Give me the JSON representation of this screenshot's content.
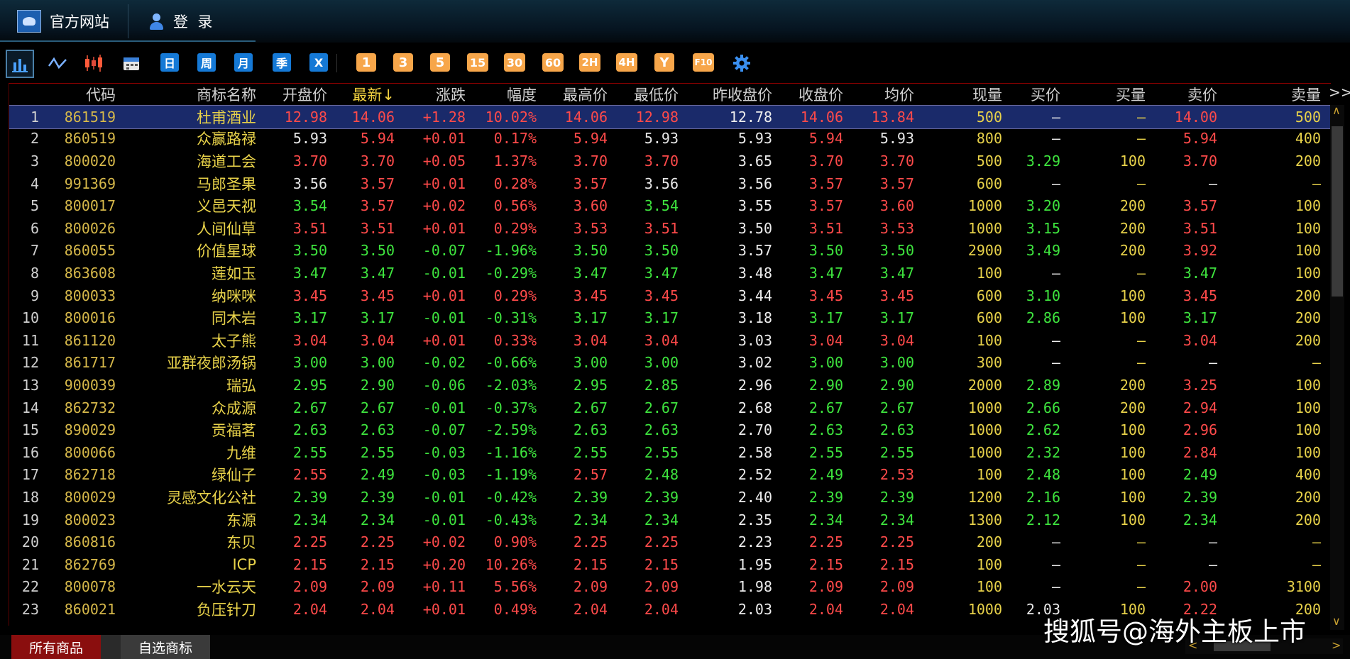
{
  "titlebar": {
    "official_site": "官方网站",
    "login": "登  录"
  },
  "toolbar": {
    "period_buttons": [
      "日",
      "周",
      "月",
      "季",
      "X"
    ],
    "minute_buttons": [
      "1",
      "3",
      "5",
      "15",
      "30",
      "60",
      "2H",
      "4H",
      "Y",
      "F10"
    ]
  },
  "table": {
    "headers": [
      "代码",
      "商标名称",
      "开盘价",
      "最新↓",
      "涨跌",
      "幅度",
      "最高价",
      "最低价",
      "昨收盘价",
      "收盘价",
      "均价",
      "现量",
      "买价",
      "买量",
      "卖价",
      "卖量"
    ],
    "more": ">>",
    "rows": [
      [
        "1",
        "861519",
        "杜甫酒业",
        "12.98",
        "14.06",
        "+1.28",
        "10.02%",
        "14.06",
        "12.98",
        "12.78",
        "14.06",
        "13.84",
        "500",
        "—",
        "—",
        "14.00",
        "500"
      ],
      [
        "2",
        "860519",
        "众赢路禄",
        "5.93",
        "5.94",
        "+0.01",
        "0.17%",
        "5.94",
        "5.93",
        "5.93",
        "5.94",
        "5.93",
        "800",
        "—",
        "—",
        "5.94",
        "400"
      ],
      [
        "3",
        "800020",
        "海道工会",
        "3.70",
        "3.70",
        "+0.05",
        "1.37%",
        "3.70",
        "3.70",
        "3.65",
        "3.70",
        "3.70",
        "500",
        "3.29",
        "100",
        "3.70",
        "200"
      ],
      [
        "4",
        "991369",
        "马郎圣果",
        "3.56",
        "3.57",
        "+0.01",
        "0.28%",
        "3.57",
        "3.56",
        "3.56",
        "3.57",
        "3.57",
        "600",
        "—",
        "—",
        "—",
        "—"
      ],
      [
        "5",
        "800017",
        "义邑天视",
        "3.54",
        "3.57",
        "+0.02",
        "0.56%",
        "3.60",
        "3.54",
        "3.55",
        "3.57",
        "3.60",
        "1000",
        "3.20",
        "200",
        "3.57",
        "100"
      ],
      [
        "6",
        "800026",
        "人间仙草",
        "3.51",
        "3.51",
        "+0.01",
        "0.29%",
        "3.53",
        "3.51",
        "3.50",
        "3.51",
        "3.53",
        "1000",
        "3.15",
        "200",
        "3.51",
        "100"
      ],
      [
        "7",
        "860055",
        "价值星球",
        "3.50",
        "3.50",
        "-0.07",
        "-1.96%",
        "3.50",
        "3.50",
        "3.57",
        "3.50",
        "3.50",
        "2900",
        "3.49",
        "200",
        "3.92",
        "100"
      ],
      [
        "8",
        "863608",
        "莲如玉",
        "3.47",
        "3.47",
        "-0.01",
        "-0.29%",
        "3.47",
        "3.47",
        "3.48",
        "3.47",
        "3.47",
        "100",
        "—",
        "—",
        "3.47",
        "100"
      ],
      [
        "9",
        "800033",
        "纳咪咪",
        "3.45",
        "3.45",
        "+0.01",
        "0.29%",
        "3.45",
        "3.45",
        "3.44",
        "3.45",
        "3.45",
        "600",
        "3.10",
        "100",
        "3.45",
        "200"
      ],
      [
        "10",
        "800016",
        "同木岩",
        "3.17",
        "3.17",
        "-0.01",
        "-0.31%",
        "3.17",
        "3.17",
        "3.18",
        "3.17",
        "3.17",
        "600",
        "2.86",
        "100",
        "3.17",
        "200"
      ],
      [
        "11",
        "861120",
        "太子熊",
        "3.04",
        "3.04",
        "+0.01",
        "0.33%",
        "3.04",
        "3.04",
        "3.03",
        "3.04",
        "3.04",
        "100",
        "—",
        "—",
        "3.04",
        "200"
      ],
      [
        "12",
        "861717",
        "亚群夜郎汤锅",
        "3.00",
        "3.00",
        "-0.02",
        "-0.66%",
        "3.00",
        "3.00",
        "3.02",
        "3.00",
        "3.00",
        "300",
        "—",
        "—",
        "—",
        "—"
      ],
      [
        "13",
        "900039",
        "瑞弘",
        "2.95",
        "2.90",
        "-0.06",
        "-2.03%",
        "2.95",
        "2.85",
        "2.96",
        "2.90",
        "2.90",
        "2000",
        "2.89",
        "200",
        "3.25",
        "100"
      ],
      [
        "14",
        "862732",
        "众成源",
        "2.67",
        "2.67",
        "-0.01",
        "-0.37%",
        "2.67",
        "2.67",
        "2.68",
        "2.67",
        "2.67",
        "1000",
        "2.66",
        "200",
        "2.94",
        "100"
      ],
      [
        "15",
        "890029",
        "贡福茗",
        "2.63",
        "2.63",
        "-0.07",
        "-2.59%",
        "2.63",
        "2.63",
        "2.70",
        "2.63",
        "2.63",
        "1000",
        "2.62",
        "100",
        "2.96",
        "100"
      ],
      [
        "16",
        "800066",
        "九维",
        "2.55",
        "2.55",
        "-0.03",
        "-1.16%",
        "2.55",
        "2.55",
        "2.58",
        "2.55",
        "2.55",
        "1000",
        "2.32",
        "100",
        "2.84",
        "100"
      ],
      [
        "17",
        "862718",
        "绿仙子",
        "2.55",
        "2.49",
        "-0.03",
        "-1.19%",
        "2.57",
        "2.48",
        "2.52",
        "2.49",
        "2.53",
        "100",
        "2.48",
        "100",
        "2.49",
        "400"
      ],
      [
        "18",
        "800029",
        "灵感文化公社",
        "2.39",
        "2.39",
        "-0.01",
        "-0.42%",
        "2.39",
        "2.39",
        "2.40",
        "2.39",
        "2.39",
        "1200",
        "2.16",
        "100",
        "2.39",
        "200"
      ],
      [
        "19",
        "800023",
        "东源",
        "2.34",
        "2.34",
        "-0.01",
        "-0.43%",
        "2.34",
        "2.34",
        "2.35",
        "2.34",
        "2.34",
        "1300",
        "2.12",
        "100",
        "2.34",
        "200"
      ],
      [
        "20",
        "860816",
        "东贝",
        "2.25",
        "2.25",
        "+0.02",
        "0.90%",
        "2.25",
        "2.25",
        "2.23",
        "2.25",
        "2.25",
        "200",
        "—",
        "—",
        "—",
        "—"
      ],
      [
        "21",
        "862769",
        "ICP",
        "2.15",
        "2.15",
        "+0.20",
        "10.26%",
        "2.15",
        "2.15",
        "1.95",
        "2.15",
        "2.15",
        "100",
        "—",
        "—",
        "—",
        "—"
      ],
      [
        "22",
        "800078",
        "一水云天",
        "2.09",
        "2.09",
        "+0.11",
        "5.56%",
        "2.09",
        "2.09",
        "1.98",
        "2.09",
        "2.09",
        "100",
        "—",
        "—",
        "2.00",
        "3100"
      ],
      [
        "23",
        "860021",
        "负压针刀",
        "2.04",
        "2.04",
        "+0.01",
        "0.49%",
        "2.04",
        "2.04",
        "2.03",
        "2.04",
        "2.04",
        "1000",
        "2.03",
        "100",
        "2.22",
        "200"
      ]
    ]
  },
  "bottom_tabs": {
    "all": "所有商品",
    "watch": "自选商标"
  },
  "watermark": "搜狐号@海外主板上市",
  "colors": {
    "up": "#ff4a4a",
    "down": "#3ee43e",
    "flat": "#e8e8e8",
    "name": "#e8d24a",
    "code": "#d6b84a",
    "tab_active": "#8a0e0e"
  }
}
